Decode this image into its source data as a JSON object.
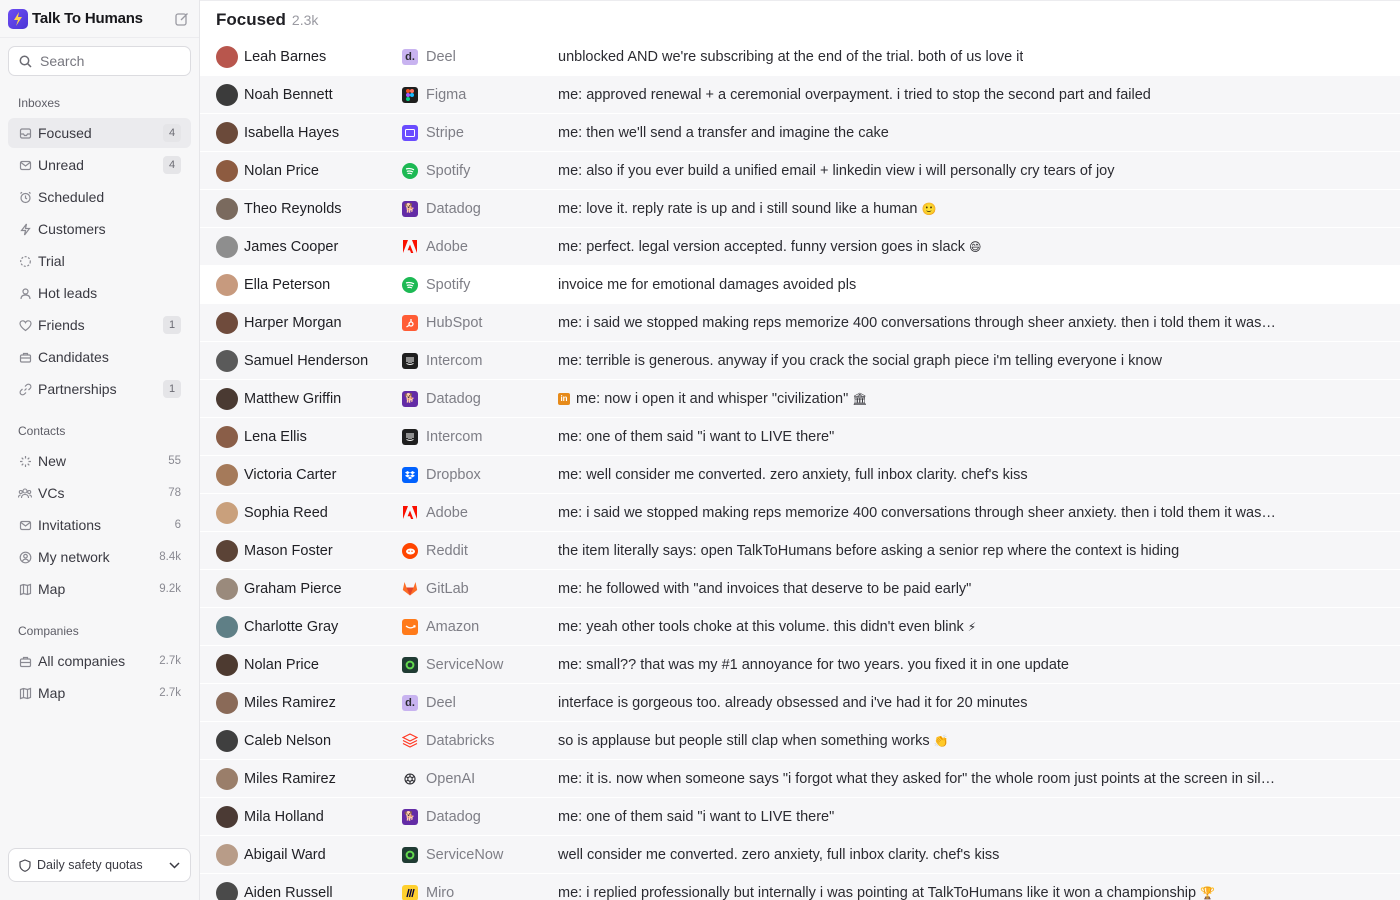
{
  "app": {
    "name": "Talk To Humans"
  },
  "search": {
    "placeholder": "Search"
  },
  "sidebar": {
    "inboxes_title": "Inboxes",
    "inboxes": [
      {
        "label": "Focused",
        "badge": "4",
        "icon": "inbox-stack-icon"
      },
      {
        "label": "Unread",
        "badge": "4",
        "icon": "envelope-icon"
      },
      {
        "label": "Scheduled",
        "badge": "",
        "icon": "alarm-clock-icon"
      },
      {
        "label": "Customers",
        "badge": "",
        "icon": "lightning-icon"
      },
      {
        "label": "Trial",
        "badge": "",
        "icon": "dashed-circle-icon"
      },
      {
        "label": "Hot leads",
        "badge": "",
        "icon": "person-icon"
      },
      {
        "label": "Friends",
        "badge": "1",
        "icon": "heart-icon"
      },
      {
        "label": "Candidates",
        "badge": "",
        "icon": "briefcase-icon"
      },
      {
        "label": "Partnerships",
        "badge": "1",
        "icon": "link-icon"
      }
    ],
    "contacts_title": "Contacts",
    "contacts": [
      {
        "label": "New",
        "count": "55",
        "icon": "sparkle-icon"
      },
      {
        "label": "VCs",
        "count": "78",
        "icon": "people-group-icon"
      },
      {
        "label": "Invitations",
        "count": "6",
        "icon": "envelope-icon"
      },
      {
        "label": "My network",
        "count": "8.4k",
        "icon": "user-circle-icon"
      },
      {
        "label": "Map",
        "count": "9.2k",
        "icon": "map-icon"
      }
    ],
    "companies_title": "Companies",
    "companies": [
      {
        "label": "All companies",
        "count": "2.7k",
        "icon": "building-icon"
      },
      {
        "label": "Map",
        "count": "2.7k",
        "icon": "map-icon"
      }
    ],
    "quota_label": "Daily safety quotas"
  },
  "main": {
    "title": "Focused",
    "count": "2.3k",
    "rows": [
      {
        "name": "Leah Barnes",
        "company": "Deel",
        "clogo": "deel",
        "message": "unblocked AND we're subscribing at the end of the trial. both of us love it",
        "emoji": "",
        "white": true,
        "li": false,
        "avatar": "#b8564d"
      },
      {
        "name": "Noah Bennett",
        "company": "Figma",
        "clogo": "figma",
        "message": "me: approved renewal + a ceremonial overpayment. i tried to stop the second part and failed",
        "emoji": "",
        "white": false,
        "li": false,
        "avatar": "#3b3b3b"
      },
      {
        "name": "Isabella Hayes",
        "company": "Stripe",
        "clogo": "stripe",
        "message": "me: then we'll send a transfer and imagine the cake",
        "emoji": "",
        "white": false,
        "li": false,
        "avatar": "#6b4a3a"
      },
      {
        "name": "Nolan Price",
        "company": "Spotify",
        "clogo": "spotify",
        "message": "me: also if you ever build a unified email + linkedin view i will personally cry tears of joy",
        "emoji": "",
        "white": false,
        "li": false,
        "avatar": "#8d5b40"
      },
      {
        "name": "Theo Reynolds",
        "company": "Datadog",
        "clogo": "datadog",
        "message": "me: love it. reply rate is up and i still sound like a human",
        "emoji": "🙂",
        "white": false,
        "li": false,
        "avatar": "#7a6a5e"
      },
      {
        "name": "James Cooper",
        "company": "Adobe",
        "clogo": "adobe",
        "message": "me: perfect. legal version accepted. funny version goes in slack",
        "emoji": "😄",
        "white": false,
        "li": false,
        "avatar": "#8e8e8e"
      },
      {
        "name": "Ella Peterson",
        "company": "Spotify",
        "clogo": "spotify",
        "message": "invoice me for emotional damages avoided pls",
        "emoji": "",
        "white": true,
        "li": false,
        "avatar": "#c79a7e"
      },
      {
        "name": "Harper Morgan",
        "company": "HubSpot",
        "clogo": "hubspot",
        "message": "me: i said we stopped making reps memorize 400 conversations through sheer anxiety. then i told them it was…",
        "emoji": "",
        "white": false,
        "li": false,
        "avatar": "#6f4b3c"
      },
      {
        "name": "Samuel Henderson",
        "company": "Intercom",
        "clogo": "intercom",
        "message": "me: terrible is generous. anyway if you crack the social graph piece i'm telling everyone i know",
        "emoji": "",
        "white": false,
        "li": false,
        "avatar": "#5a5a5a"
      },
      {
        "name": "Matthew Griffin",
        "company": "Datadog",
        "clogo": "datadog",
        "message": "me: now i open it and whisper \"civilization\"",
        "emoji": "🏛",
        "white": false,
        "li": true,
        "avatar": "#4a3a32"
      },
      {
        "name": "Lena Ellis",
        "company": "Intercom",
        "clogo": "intercom",
        "message": "me: one of them said \"i want to LIVE there\"",
        "emoji": "",
        "white": false,
        "li": false,
        "avatar": "#8a5e48"
      },
      {
        "name": "Victoria Carter",
        "company": "Dropbox",
        "clogo": "dropbox",
        "message": "me: well consider me converted. zero anxiety, full inbox clarity. chef's kiss",
        "emoji": "",
        "white": false,
        "li": false,
        "avatar": "#a57a5a"
      },
      {
        "name": "Sophia Reed",
        "company": "Adobe",
        "clogo": "adobe",
        "message": "me: i said we stopped making reps memorize 400 conversations through sheer anxiety. then i told them it was…",
        "emoji": "",
        "white": false,
        "li": false,
        "avatar": "#c9a07c"
      },
      {
        "name": "Mason Foster",
        "company": "Reddit",
        "clogo": "reddit",
        "message": "the item literally says: open TalkToHumans before asking a senior rep where the context is hiding",
        "emoji": "",
        "white": false,
        "li": false,
        "avatar": "#5b4336"
      },
      {
        "name": "Graham Pierce",
        "company": "GitLab",
        "clogo": "gitlab",
        "message": "me: he followed with \"and invoices that deserve to be paid early\"",
        "emoji": "",
        "white": false,
        "li": false,
        "avatar": "#9a8a7c"
      },
      {
        "name": "Charlotte Gray",
        "company": "Amazon",
        "clogo": "amazon",
        "message": "me: yeah other tools choke at this volume. this didn't even blink",
        "emoji": "⚡",
        "white": false,
        "li": false,
        "avatar": "#5f7f86"
      },
      {
        "name": "Nolan Price",
        "company": "ServiceNow",
        "clogo": "servicenow",
        "message": "me: small?? that was my #1 annoyance for two years. you fixed it in one update",
        "emoji": "",
        "white": false,
        "li": false,
        "avatar": "#4d3a30"
      },
      {
        "name": "Miles Ramirez",
        "company": "Deel",
        "clogo": "deel",
        "message": "interface is gorgeous too. already obsessed and i've had it for 20 minutes",
        "emoji": "",
        "white": false,
        "li": false,
        "avatar": "#8a6a58"
      },
      {
        "name": "Caleb Nelson",
        "company": "Databricks",
        "clogo": "databricks",
        "message": "so is applause but people still clap when something works",
        "emoji": "👏",
        "white": false,
        "li": false,
        "avatar": "#3f3f3f"
      },
      {
        "name": "Miles Ramirez",
        "company": "OpenAI",
        "clogo": "openai",
        "message": "me: it is. now when someone says \"i forgot what they asked for\" the whole room just points at the screen in sil…",
        "emoji": "",
        "white": false,
        "li": false,
        "avatar": "#9a7e6a"
      },
      {
        "name": "Mila Holland",
        "company": "Datadog",
        "clogo": "datadog",
        "message": "me: one of them said \"i want to LIVE there\"",
        "emoji": "",
        "white": false,
        "li": false,
        "avatar": "#4b3a34"
      },
      {
        "name": "Abigail Ward",
        "company": "ServiceNow",
        "clogo": "servicenow",
        "message": "well consider me converted. zero anxiety, full inbox clarity. chef's kiss",
        "emoji": "",
        "white": false,
        "li": false,
        "avatar": "#b89c88"
      },
      {
        "name": "Aiden Russell",
        "company": "Miro",
        "clogo": "miro",
        "message": "me: i replied professionally but internally i was pointing at TalkToHumans like it won a championship",
        "emoji": "🏆",
        "white": false,
        "li": false,
        "avatar": "#4a4a4a"
      }
    ]
  },
  "colors": {
    "brand": "#5b3fe6",
    "sidebar_bg": "#f7f7f8",
    "row_bg": "#f6f6f8",
    "row_highlight": "#ffffff"
  }
}
